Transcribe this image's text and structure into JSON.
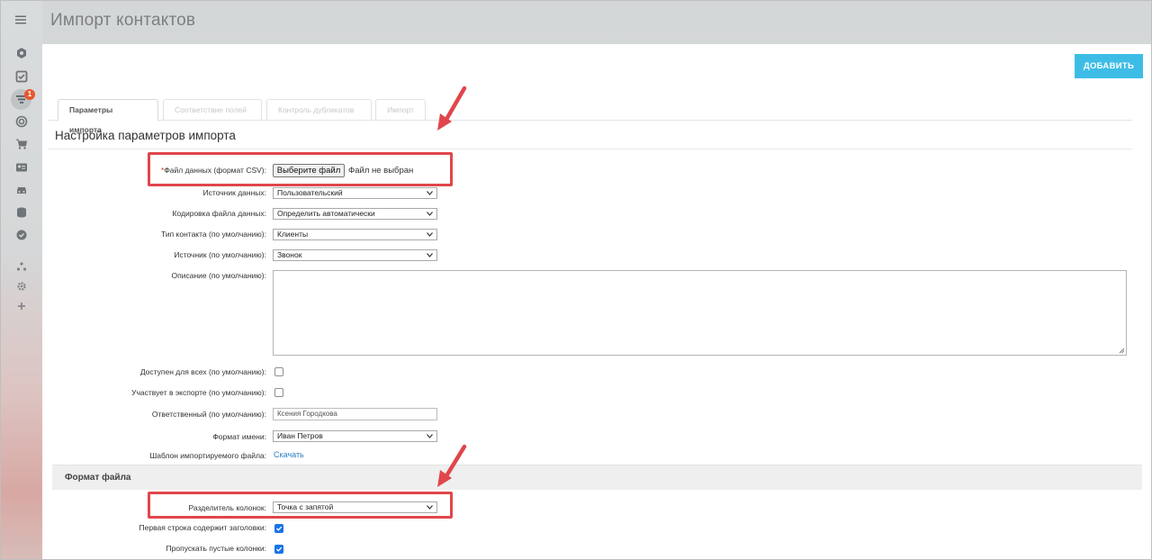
{
  "header": {
    "title": "Импорт контактов"
  },
  "sidebar": {
    "badge": "1",
    "icons": [
      "dashboard-icon",
      "tasks-icon",
      "filter-icon",
      "target-icon",
      "cart-icon",
      "contacts-icon",
      "car-icon",
      "database-icon",
      "check-circle-icon",
      "structure-icon",
      "gear-icon",
      "plus-icon"
    ]
  },
  "toolbar": {
    "add_label": "ДОБАВИТЬ"
  },
  "tabs": [
    {
      "label": "Параметры импорта"
    },
    {
      "label": "Соответствие полей"
    },
    {
      "label": "Контроль дубликатов"
    },
    {
      "label": "Импорт"
    }
  ],
  "section": {
    "title": "Настройка параметров импорта"
  },
  "form": {
    "file": {
      "required_mark": "*",
      "label": "Файл данных (формат CSV):",
      "button": "Выберите файл",
      "status": "Файл не выбран"
    },
    "data_source": {
      "label": "Источник данных:",
      "value": "Пользовательский"
    },
    "encoding": {
      "label": "Кодировка файла данных:",
      "value": "Определить автоматически"
    },
    "contact_type": {
      "label": "Тип контакта (по умолчанию):",
      "value": "Клиенты"
    },
    "source": {
      "label": "Источник (по умолчанию):",
      "value": "Звонок"
    },
    "description": {
      "label": "Описание (по умолчанию):",
      "value": ""
    },
    "available_all": {
      "label": "Доступен для всех (по умолчанию):",
      "checked": false
    },
    "in_export": {
      "label": "Участвует в экспорте (по умолчанию):",
      "checked": false
    },
    "responsible": {
      "label": "Ответственный (по умолчанию):",
      "value": "Ксения Городкова"
    },
    "name_format": {
      "label": "Формат имени:",
      "value": "Иван Петров"
    },
    "template": {
      "label": "Шаблон импортируемого файла:",
      "link": "Скачать"
    }
  },
  "file_format": {
    "title": "Формат файла",
    "separator": {
      "label": "Разделитель колонок:",
      "value": "Точка с запятой"
    },
    "first_row_headers": {
      "label": "Первая строка содержит заголовки:",
      "checked": true
    },
    "skip_empty": {
      "label": "Пропускать пустые колонки:",
      "checked": true
    }
  },
  "colors": {
    "accent": "#3dbde6",
    "highlight": "#e0464b",
    "link": "#2a7dc4"
  }
}
